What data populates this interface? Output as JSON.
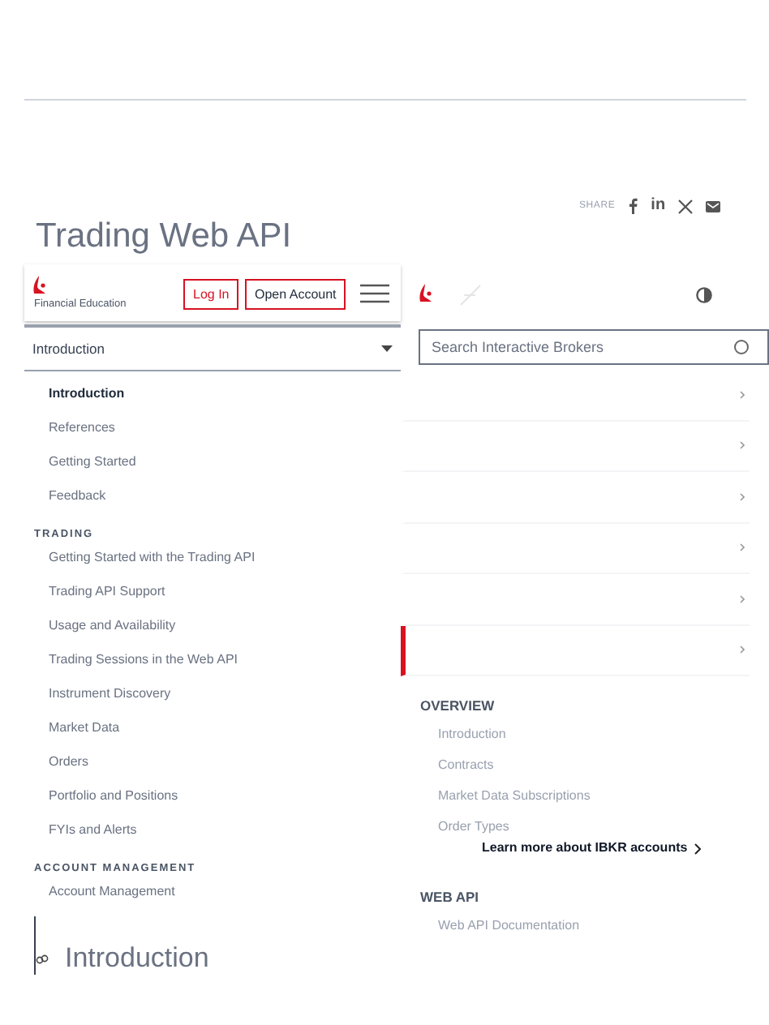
{
  "share": {
    "label": "SHARE",
    "linkedin": "in"
  },
  "page_title": "Trading Web API",
  "header": {
    "brand_caption": "Financial Education",
    "login": "Log In",
    "open_account": "Open Account"
  },
  "dropdown": {
    "value": "Introduction"
  },
  "nav": [
    {
      "kind": "item",
      "label": "Introduction",
      "selected": true
    },
    {
      "kind": "item",
      "label": "References",
      "selected": false
    },
    {
      "kind": "item",
      "label": "Getting Started",
      "selected": false
    },
    {
      "kind": "item",
      "label": "Feedback",
      "selected": false
    },
    {
      "kind": "heading",
      "label": "TRADING"
    },
    {
      "kind": "item",
      "label": "Getting Started with the Trading API",
      "selected": false
    },
    {
      "kind": "item",
      "label": "Trading API Support",
      "selected": false
    },
    {
      "kind": "item",
      "label": "Usage and Availability",
      "selected": false
    },
    {
      "kind": "item",
      "label": "Trading Sessions in the Web API",
      "selected": false
    },
    {
      "kind": "item",
      "label": "Instrument Discovery",
      "selected": false
    },
    {
      "kind": "item",
      "label": "Market Data",
      "selected": false
    },
    {
      "kind": "item",
      "label": "Orders",
      "selected": false
    },
    {
      "kind": "item",
      "label": "Portfolio and Positions",
      "selected": false
    },
    {
      "kind": "item",
      "label": "FYIs and Alerts",
      "selected": false
    },
    {
      "kind": "heading",
      "label": "ACCOUNT MANAGEMENT"
    },
    {
      "kind": "item",
      "label": "Account Management",
      "selected": false
    }
  ],
  "section_heading": "Introduction",
  "search": {
    "placeholder": "Search Interactive Brokers"
  },
  "accordion_rows": [
    {
      "selected": false
    },
    {
      "selected": false
    },
    {
      "selected": false
    },
    {
      "selected": false
    },
    {
      "selected": false
    },
    {
      "selected": true
    }
  ],
  "overview": {
    "heading": "OVERVIEW",
    "items": [
      "Introduction",
      "Contracts",
      "Market Data Subscriptions",
      "Order Types"
    ]
  },
  "learn_more": "Learn more about IBKR accounts",
  "web_api": {
    "heading": "WEB API",
    "items": [
      "Web API Documentation"
    ]
  }
}
